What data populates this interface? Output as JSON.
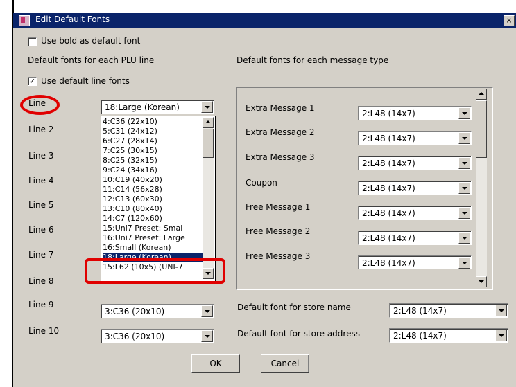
{
  "window": {
    "title": "Edit Default Fonts",
    "close_glyph": "×"
  },
  "options": {
    "bold_default": {
      "label": "Use bold as default font",
      "checked": false
    },
    "plu_heading": "Default fonts for each PLU line",
    "message_heading": "Default fonts for each message type",
    "use_line_fonts": {
      "label": "Use default line fonts",
      "checked": true,
      "mark": "✓"
    }
  },
  "plu_lines": [
    {
      "label": "Line",
      "value": "18:Large (Korean)"
    },
    {
      "label": "Line 2",
      "value": ""
    },
    {
      "label": "Line 3",
      "value": ""
    },
    {
      "label": "Line 4",
      "value": ""
    },
    {
      "label": "Line 5",
      "value": ""
    },
    {
      "label": "Line 6",
      "value": ""
    },
    {
      "label": "Line 7",
      "value": ""
    },
    {
      "label": "Line 8",
      "value": ""
    },
    {
      "label": "Line 9",
      "value": "3:C36 (20x10)"
    },
    {
      "label": "Line 10",
      "value": "3:C36 (20x10)"
    }
  ],
  "dropdown_list": {
    "items": [
      "4:C36 (22x10)",
      "5:C31 (24x12)",
      "6:C27 (28x14)",
      "7:C25 (30x15)",
      "8:C25 (32x15)",
      "9:C24 (34x16)",
      "10:C19 (40x20)",
      "11:C14 (56x28)",
      "12:C13 (60x30)",
      "13:C10 (80x40)",
      "14:C7 (120x60)",
      "15:Uni7 Preset: Smal",
      "16:Uni7 Preset: Large",
      "16:Small (Korean)",
      "18:Large (Korean)",
      "15:L62 (10x5) (UNI-7"
    ],
    "selected": "18:Large (Korean)"
  },
  "message_types": [
    {
      "label": "Extra Message 1",
      "value": "2:L48 (14x7)"
    },
    {
      "label": "Extra Message 2",
      "value": "2:L48 (14x7)"
    },
    {
      "label": "Extra Message 3",
      "value": "2:L48 (14x7)"
    },
    {
      "label": "Coupon",
      "value": "2:L48 (14x7)"
    },
    {
      "label": "Free Message 1",
      "value": "2:L48 (14x7)"
    },
    {
      "label": "Free Message 2",
      "value": "2:L48 (14x7)"
    },
    {
      "label": "Free Message 3",
      "value": "2:L48 (14x7)"
    }
  ],
  "store": {
    "name_label": "Default font for store name",
    "name_value": "2:L48 (14x7)",
    "address_label": "Default font for store address",
    "address_value": "2:L48 (14x7)"
  },
  "buttons": {
    "ok": "OK",
    "cancel": "Cancel"
  },
  "colors": {
    "annotation": "#e00000",
    "selection": "#0a246a",
    "dialog": "#d4d0c8"
  }
}
